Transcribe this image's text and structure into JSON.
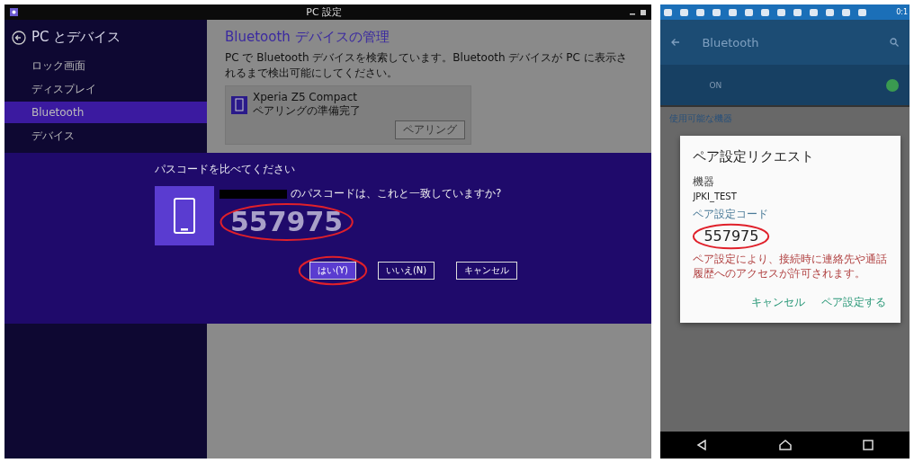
{
  "pc_settings": {
    "window": {
      "title": "PC 設定"
    },
    "sidebar": {
      "title": "PC とデバイス",
      "items": [
        {
          "label": "ロック画面",
          "selected": false
        },
        {
          "label": "ディスプレイ",
          "selected": false
        },
        {
          "label": "Bluetooth",
          "selected": true
        },
        {
          "label": "デバイス",
          "selected": false
        }
      ]
    },
    "content": {
      "heading": "Bluetooth デバイスの管理",
      "description": "PC で Bluetooth デバイスを検索しています。Bluetooth デバイスが PC に表示されるまで検出可能にしてください。",
      "device": {
        "name": "Xperia Z5 Compact",
        "status": "ペアリングの準備完了",
        "button": "ペアリング"
      }
    },
    "dialog": {
      "title": "パスコードを比べてください",
      "question": "のパスコードは、これと一致していますか?",
      "passcode": {
        "text": "557975",
        "circled": true
      },
      "buttons": [
        {
          "label": "はい(Y)",
          "primary": true,
          "circled": true
        },
        {
          "label": "いいえ(N)",
          "primary": false,
          "circled": false
        },
        {
          "label": "キャンセル",
          "primary": false,
          "circled": false
        }
      ]
    }
  },
  "android": {
    "status_bar": {
      "time": "0:1"
    },
    "toolbar": {
      "title": "Bluetooth"
    },
    "toggle": {
      "label": "ON",
      "on": true
    },
    "section_header": "使用可能な機器",
    "dialog": {
      "title": "ペア設定リクエスト",
      "device_label": "機器",
      "device_name": "JPKI_TEST",
      "code_label": "ペア設定コード",
      "code": {
        "text": "557975",
        "circled": true
      },
      "note": "ペア設定により、接続時に連絡先や通話履歴へのアクセスが許可されます。",
      "buttons": [
        "キャンセル",
        "ペア設定する"
      ]
    }
  }
}
